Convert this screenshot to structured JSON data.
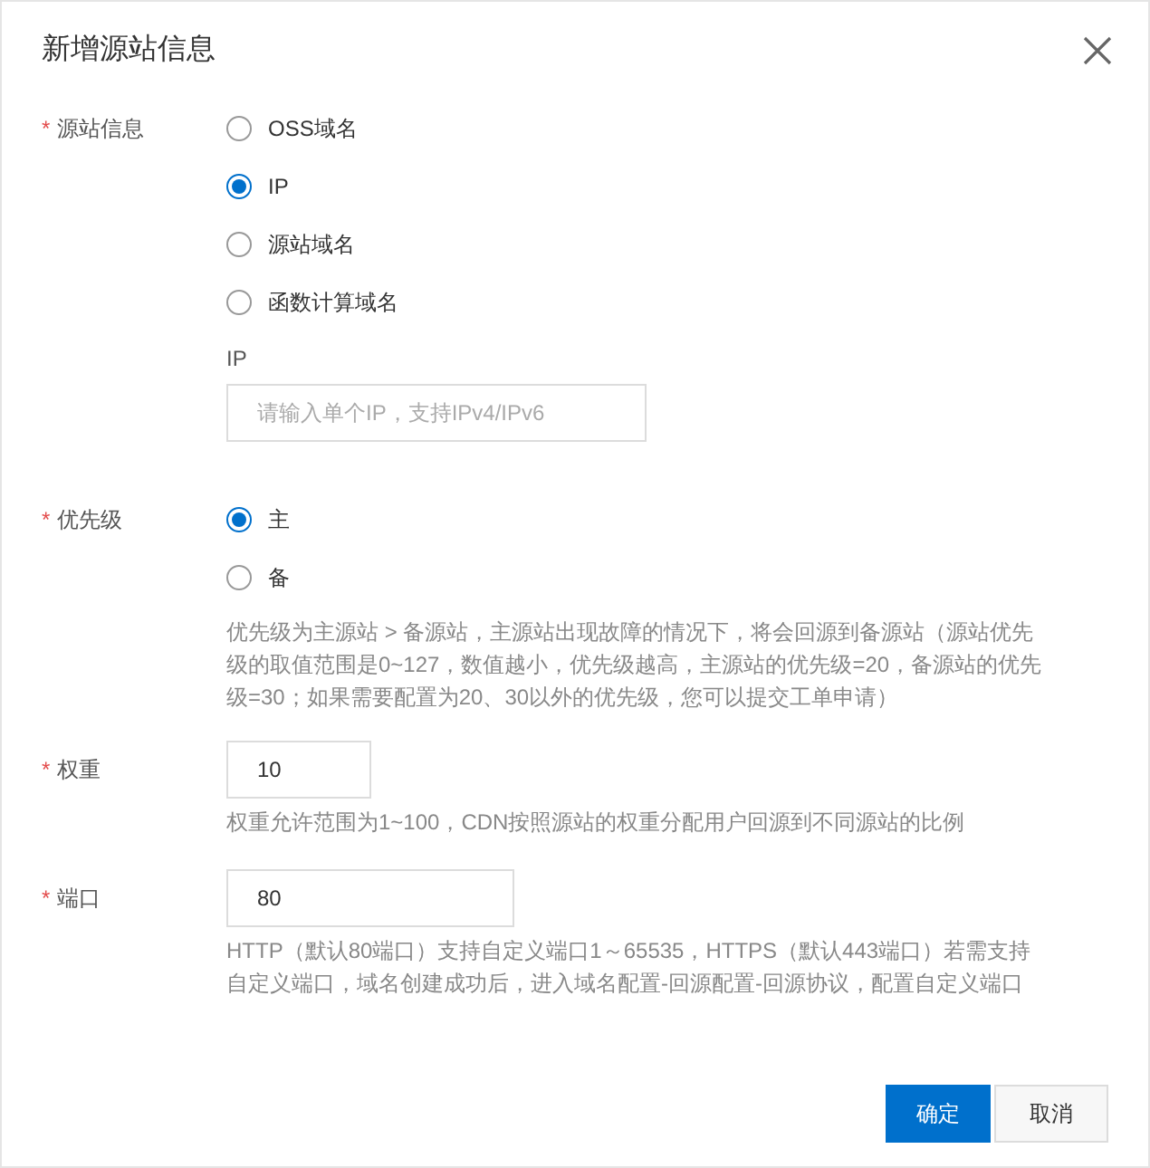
{
  "dialog": {
    "title": "新增源站信息"
  },
  "fields": [
    {
      "kind": "radio",
      "label": "源站信息",
      "required_mark": "*",
      "options": [
        {
          "label": "OSS域名",
          "selected": false
        },
        {
          "label": "IP",
          "selected": true
        },
        {
          "label": "源站域名",
          "selected": false
        },
        {
          "label": "函数计算域名",
          "selected": false
        }
      ],
      "sub_field": {
        "label": "IP",
        "placeholder": "请输入单个IP，支持IPv4/IPv6"
      }
    },
    {
      "kind": "radio",
      "label": "优先级",
      "required_mark": "*",
      "options": [
        {
          "label": "主",
          "selected": true
        },
        {
          "label": "备",
          "selected": false
        }
      ],
      "help": "优先级为主源站 > 备源站，主源站出现故障的情况下，将会回源到备源站（源站优先级的取值范围是0~127，数值越小，优先级越高，主源站的优先级=20，备源站的优先级=30；如果需要配置为20、30以外的优先级，您可以提交工单申请）"
    },
    {
      "kind": "input",
      "label": "权重",
      "required_mark": "*",
      "value": "10",
      "help": "权重允许范围为1~100，CDN按照源站的权重分配用户回源到不同源站的比例"
    },
    {
      "kind": "input",
      "label": "端口",
      "required_mark": "*",
      "value": "80",
      "help": "HTTP（默认80端口）支持自定义端口1～65535，HTTPS（默认443端口）若需支持自定义端口，域名创建成功后，进入域名配置-回源配置-回源协议，配置自定义端口"
    }
  ],
  "buttons": [
    {
      "label": "确定",
      "kind": "primary"
    },
    {
      "label": "取消",
      "kind": "secondary"
    }
  ]
}
